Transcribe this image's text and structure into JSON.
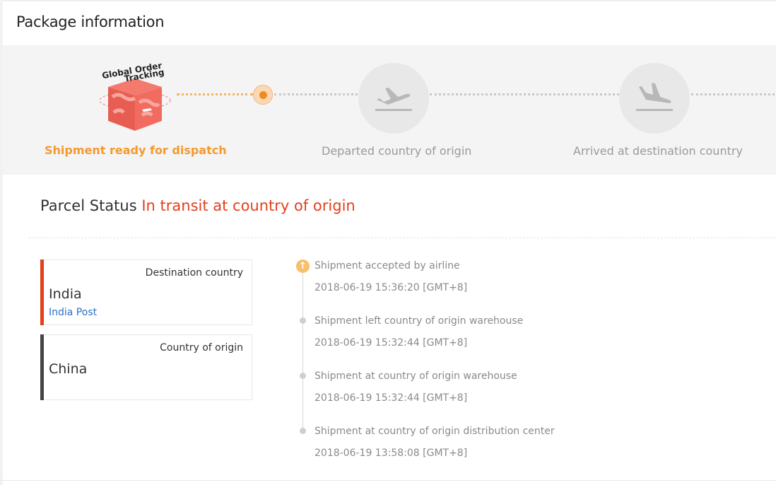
{
  "header": {
    "title": "Package information"
  },
  "progress": {
    "logo": {
      "line1": "Global Order",
      "line2": "Tracking",
      "icon": "package-box-logo"
    },
    "steps": [
      {
        "label": "Shipment ready for dispatch",
        "state": "done"
      },
      {
        "label": "Departed country of origin",
        "state": "pending",
        "icon": "plane-departure-icon"
      },
      {
        "label": "Arrived at destination country",
        "state": "pending",
        "icon": "plane-arrival-icon"
      }
    ],
    "colors": {
      "active": "#f39a2f",
      "inactive": "#9a9a9a",
      "marker": "#f08a22"
    }
  },
  "parcel": {
    "status_label": "Parcel Status",
    "status_value": "In transit at country of origin",
    "status_color": "#e2401d"
  },
  "destination": {
    "label": "Destination country",
    "country": "India",
    "carrier": "India Post",
    "accent": "#e2401d"
  },
  "origin": {
    "label": "Country of origin",
    "country": "China",
    "accent": "#444444"
  },
  "events": [
    {
      "title": "Shipment accepted by airline",
      "time": "2018-06-19 15:36:20 [GMT+8]",
      "icon": "arrow-up-icon"
    },
    {
      "title": "Shipment left country of origin warehouse",
      "time": "2018-06-19 15:32:44 [GMT+8]"
    },
    {
      "title": "Shipment at country of origin warehouse",
      "time": "2018-06-19 15:32:44 [GMT+8]"
    },
    {
      "title": "Shipment at country of origin distribution center",
      "time": "2018-06-19 13:58:08 [GMT+8]"
    }
  ]
}
